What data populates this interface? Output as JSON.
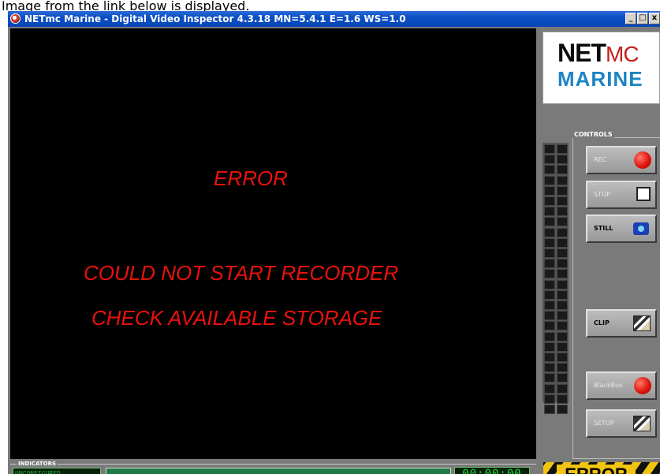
{
  "caption": "Image from the link below is displayed.",
  "window": {
    "title": "NETmc Marine - Digital Video Inspector 4.3.18 MN=5.4.1 E=1.6 WS=1.0",
    "minimize_glyph": "_",
    "maximize_glyph": "□",
    "close_glyph": "x"
  },
  "video": {
    "error_title": "ERROR",
    "error_line1": "COULD NOT START RECORDER",
    "error_line2": "CHECK AVAILABLE STORAGE"
  },
  "logo": {
    "net": "NET",
    "mc": "MC",
    "marine": "MARINE"
  },
  "controls": {
    "title": "CONTROLS",
    "rec_label": "REC",
    "stop_label": "STOP",
    "still_label": "STILL",
    "clip_label": "CLIP",
    "blackbox_label": "BlackBox",
    "setup_label": "SETUP"
  },
  "indicators": {
    "title": "INDICATORS",
    "status": "UNCONFIGURED",
    "timer": "00:00:00",
    "progress": 1.0
  },
  "error_banner": "ERROR",
  "colors": {
    "error_text": "#e8120c",
    "status_green": "#23a83a",
    "timer_green": "#21d53a",
    "hazard_yellow": "#f1c40f",
    "titlebar_blue": "#0a4ec4"
  }
}
